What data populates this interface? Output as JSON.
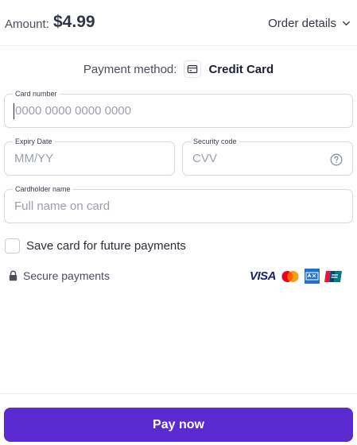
{
  "header": {
    "amount_label": "Amount:",
    "amount_value": "$4.99",
    "order_details_label": "Order details"
  },
  "payment_method": {
    "label": "Payment method:",
    "value": "Credit Card",
    "icon": "credit-card-icon"
  },
  "fields": {
    "card_number": {
      "label": "Card number",
      "placeholder": "0000 0000 0000 0000"
    },
    "expiry": {
      "label": "Expiry Date",
      "placeholder": "MM/YY"
    },
    "security": {
      "label": "Security code",
      "placeholder": "CVV",
      "help_icon": "question-circle-icon"
    },
    "cardholder": {
      "label": "Cardholder name",
      "placeholder": "Full name on card"
    }
  },
  "save_card": {
    "label": "Save card for future payments",
    "checked": false
  },
  "secure": {
    "label": "Secure payments",
    "icon": "lock-icon"
  },
  "brands": {
    "visa": "VISA",
    "items": [
      "visa-logo",
      "mastercard-logo",
      "amex-logo",
      "unionpay-logo"
    ]
  },
  "pay_button": {
    "label": "Pay now"
  },
  "colors": {
    "primary": "#5a2bd1",
    "border": "#d6d9df",
    "text": "#2b2f3a",
    "placeholder": "#9a9fab"
  }
}
